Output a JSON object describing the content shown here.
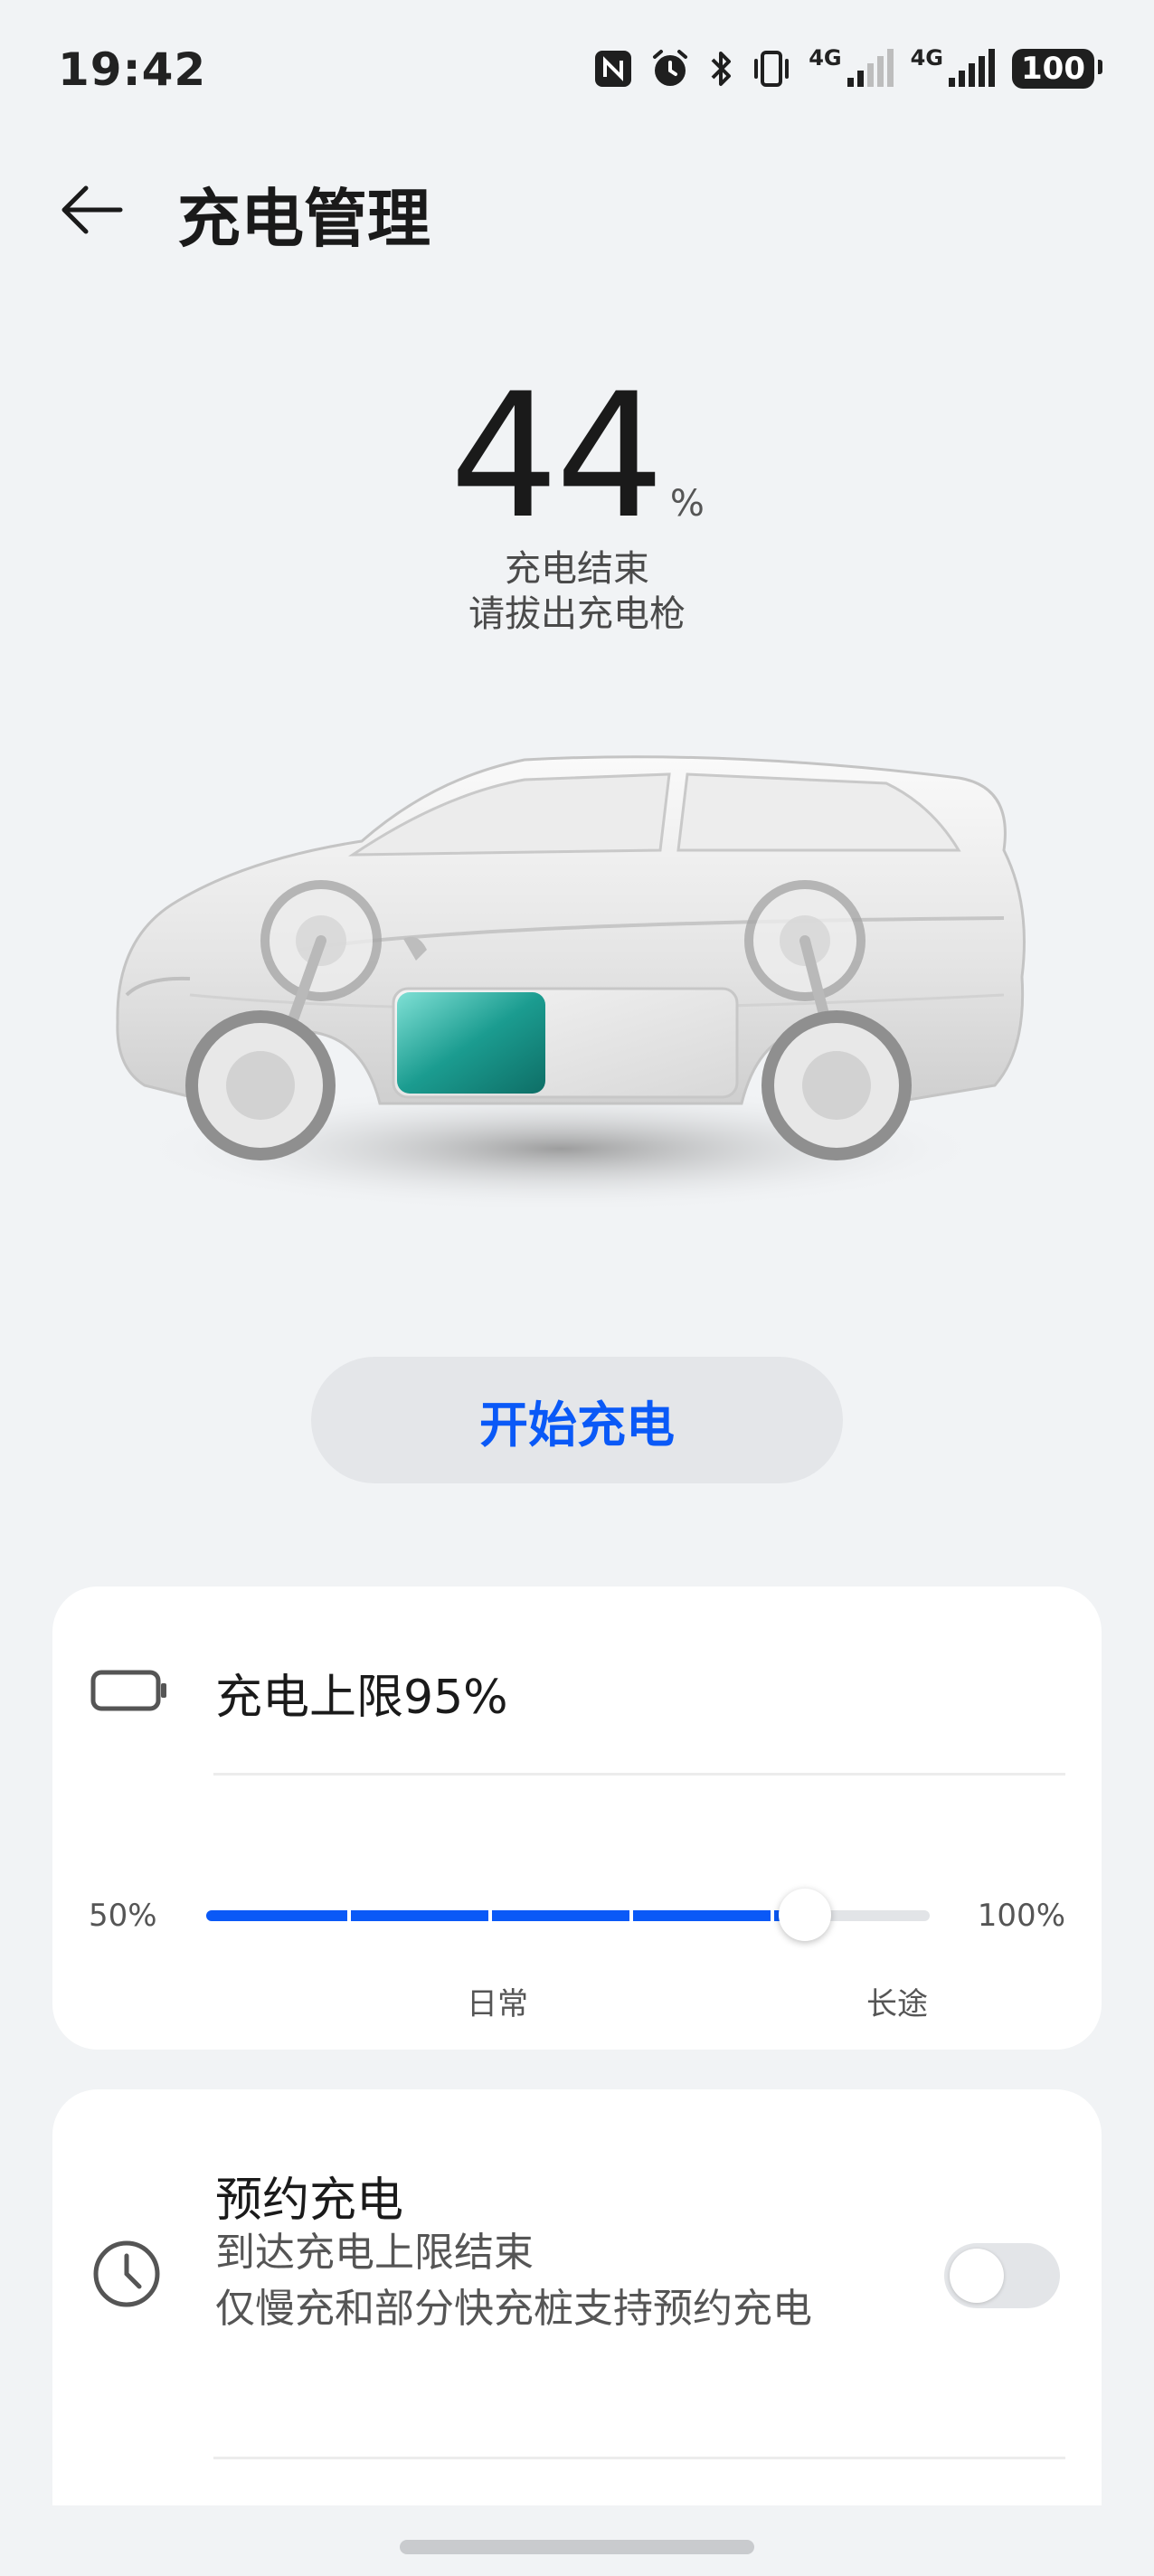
{
  "status_bar": {
    "time": "19:42",
    "net1": "4G",
    "net2": "4G",
    "battery": "100"
  },
  "header": {
    "title": "充电管理"
  },
  "charge": {
    "percent": "44",
    "unit": "%",
    "status_line1": "充电结束",
    "status_line2": "请拔出充电枪",
    "battery_fill_fraction": 0.44
  },
  "actions": {
    "start_label": "开始充电"
  },
  "limit_card": {
    "title": "充电上限95%",
    "slider_min": "50%",
    "slider_max": "100%",
    "mark_daily": "日常",
    "mark_long": "长途",
    "value_percent": 95,
    "range_min": 50,
    "range_max": 100
  },
  "reserve_card": {
    "title": "预约充电",
    "desc_line1": "到达充电上限结束",
    "desc_line2": "仅慢充和部分快充桩支持预约充电",
    "enabled": false
  },
  "colors": {
    "accent": "#0a59f7",
    "background": "#f1f3f5",
    "battery_teal": "#1fb3a5"
  }
}
